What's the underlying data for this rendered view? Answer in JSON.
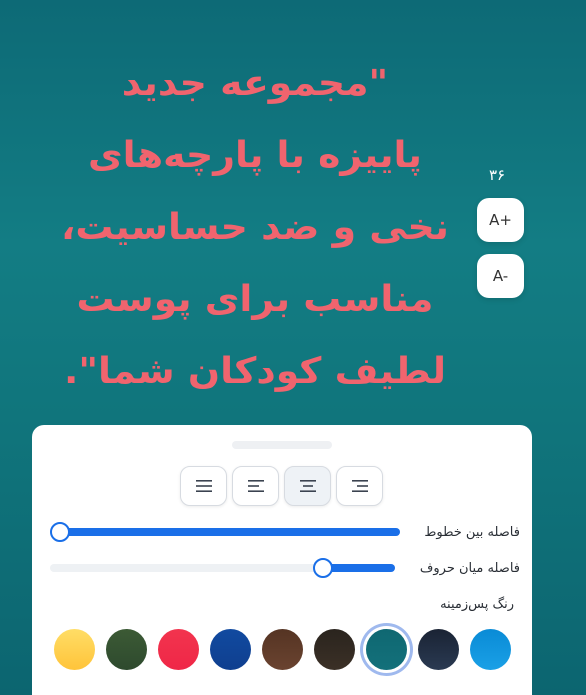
{
  "quote": {
    "lines": [
      "\"مجموعه جدید",
      "پاییزه با پارچه‌های",
      "نخی و ضد حساسیت،",
      "مناسب برای پوست",
      "لطیف کودکان شما\"."
    ]
  },
  "font_size": {
    "value": "۳۶",
    "increase_label": "A+",
    "decrease_label": "A-"
  },
  "panel": {
    "alignment_options": [
      "align-justify",
      "align-left",
      "align-center",
      "align-right"
    ],
    "selected_alignment": "align-center",
    "line_spacing": {
      "label": "فاصله بین خطوط",
      "value": 0.0
    },
    "letter_spacing": {
      "label": "فاصله میان حروف",
      "value": 0.81
    },
    "background_color_label": "رنگ پس‌زمینه",
    "background_colors": [
      {
        "name": "yellow",
        "color": "#ffc43a",
        "color2": "#ffdd66"
      },
      {
        "name": "dark-green",
        "color": "#2e4a2e",
        "color2": "#3c5a35"
      },
      {
        "name": "red",
        "color": "#ef2747",
        "color2": "#f2344e"
      },
      {
        "name": "navy",
        "color": "#0f3f8f",
        "color2": "#114aa0"
      },
      {
        "name": "brown",
        "color": "#6a4330",
        "color2": "#553423"
      },
      {
        "name": "dark-brown",
        "color": "#3b3026",
        "color2": "#2a241e"
      },
      {
        "name": "teal",
        "color": "#13707a",
        "color2": "#0f6872"
      },
      {
        "name": "dark-navy",
        "color": "#2a3a52",
        "color2": "#1a2334"
      },
      {
        "name": "sky-blue",
        "color": "#1aa0e6",
        "color2": "#0a8bd6"
      }
    ],
    "selected_background": "teal"
  }
}
